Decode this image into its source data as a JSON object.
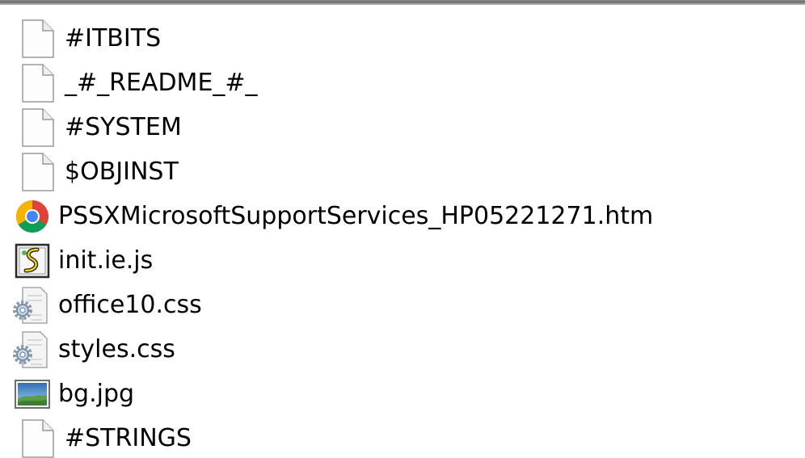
{
  "files": [
    {
      "name": "#ITBITS",
      "icon": "blank-file-icon"
    },
    {
      "name": "_#_README_#_",
      "icon": "blank-file-icon"
    },
    {
      "name": "#SYSTEM",
      "icon": "blank-file-icon"
    },
    {
      "name": "$OBJINST",
      "icon": "blank-file-icon"
    },
    {
      "name": "PSSXMicrosoftSupportServices_HP05221271.htm",
      "icon": "chrome-icon"
    },
    {
      "name": "init.ie.js",
      "icon": "script-file-icon"
    },
    {
      "name": "office10.css",
      "icon": "css-gear-file-icon"
    },
    {
      "name": "styles.css",
      "icon": "css-gear-file-icon"
    },
    {
      "name": "bg.jpg",
      "icon": "image-file-icon"
    },
    {
      "name": "#STRINGS",
      "icon": "blank-file-icon"
    }
  ]
}
